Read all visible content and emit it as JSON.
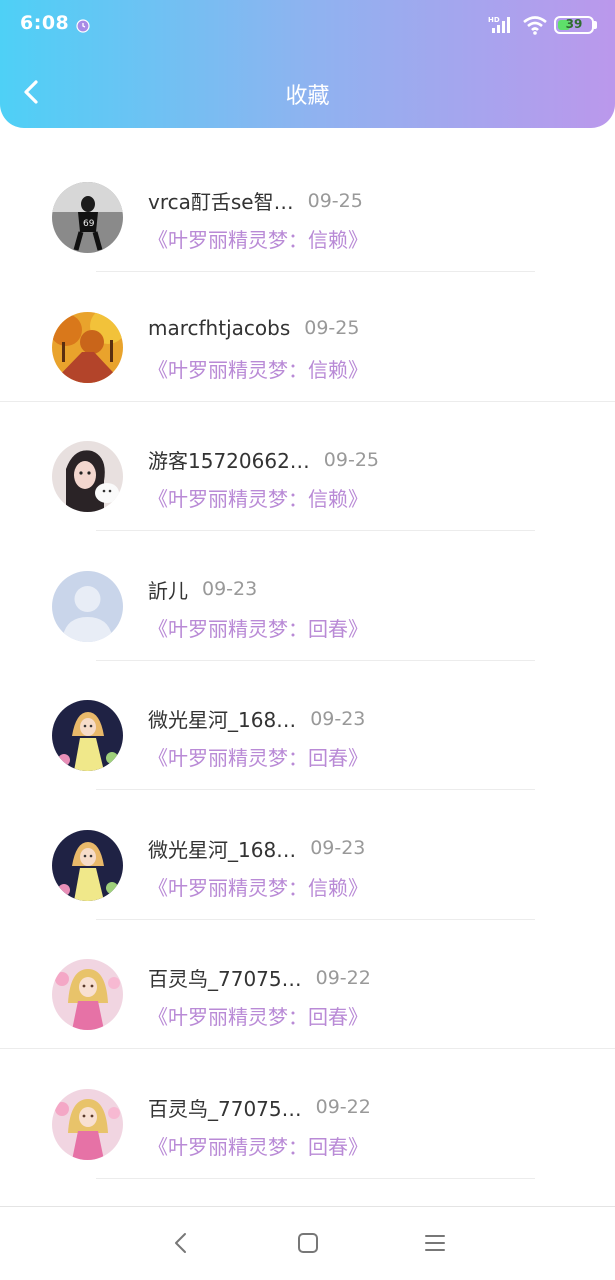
{
  "status_bar": {
    "time": "6:08",
    "network": "HD",
    "battery": "39",
    "battery_level": 0.39
  },
  "header": {
    "title": "收藏"
  },
  "items": [
    {
      "name": "vrca酊舌se智…",
      "date": "09-25",
      "work": "《叶罗丽精灵梦：信赖》",
      "avatar": "photo-bw"
    },
    {
      "name": "marcfhtjacobs",
      "date": "09-25",
      "work": "《叶罗丽精灵梦：信赖》",
      "avatar": "autumn"
    },
    {
      "name": "游客15720662…",
      "date": "09-25",
      "work": "《叶罗丽精灵梦：信赖》",
      "avatar": "girl"
    },
    {
      "name": "訢儿",
      "date": "09-23",
      "work": "《叶罗丽精灵梦：回春》",
      "avatar": "default"
    },
    {
      "name": "微光星河_168…",
      "date": "09-23",
      "work": "《叶罗丽精灵梦：回春》",
      "avatar": "doll-yellow"
    },
    {
      "name": "微光星河_168…",
      "date": "09-23",
      "work": "《叶罗丽精灵梦：信赖》",
      "avatar": "doll-yellow"
    },
    {
      "name": "百灵鸟_77075…",
      "date": "09-22",
      "work": "《叶罗丽精灵梦：回春》",
      "avatar": "doll-pink"
    },
    {
      "name": "百灵鸟_77075…",
      "date": "09-22",
      "work": "《叶罗丽精灵梦：回春》",
      "avatar": "doll-pink"
    }
  ],
  "icons": {
    "back": "chevron-left-icon",
    "nav": [
      "nav-back-icon",
      "nav-home-icon",
      "nav-menu-icon"
    ]
  },
  "colors": {
    "header_start": "#4ed0f6",
    "header_end": "#bb98ec",
    "work_text": "#b98ad6",
    "date_text": "#999999"
  }
}
